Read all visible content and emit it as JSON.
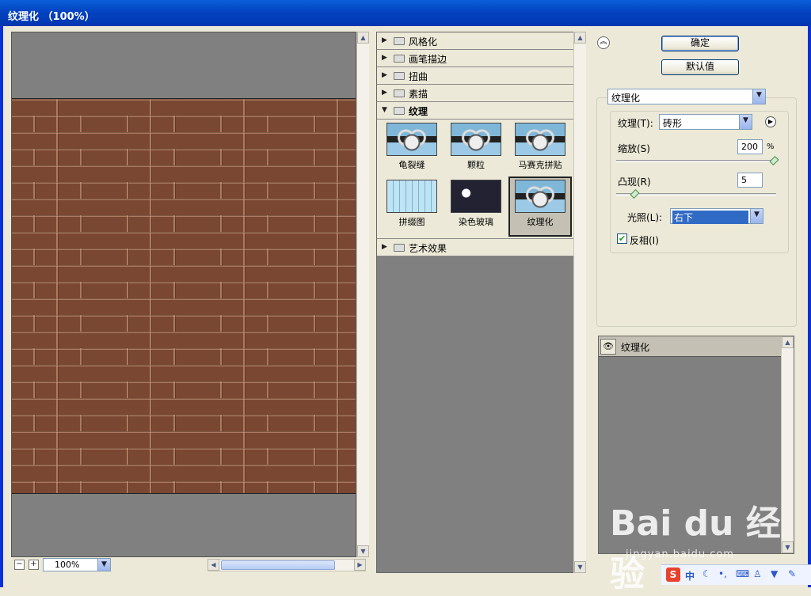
{
  "window": {
    "title": "纹理化 （100%）"
  },
  "preview": {
    "zoom": "100%"
  },
  "filter_gallery": {
    "categories_top": [
      "风格化",
      "画笔描边",
      "扭曲",
      "素描"
    ],
    "expanded": {
      "label": "纹理",
      "items": [
        {
          "label": "龟裂缝",
          "icon": "craquelure-thumbnail"
        },
        {
          "label": "颗粒",
          "icon": "grain-thumbnail"
        },
        {
          "label": "马赛克拼贴",
          "icon": "mosaic-tiles-thumbnail"
        },
        {
          "label": "拼缀图",
          "icon": "patchwork-thumbnail"
        },
        {
          "label": "染色玻璃",
          "icon": "stained-glass-thumbnail"
        },
        {
          "label": "纹理化",
          "icon": "texturizer-thumbnail",
          "selected": true
        }
      ]
    },
    "categories_bottom": [
      "艺术效果"
    ]
  },
  "buttons": {
    "ok": "确定",
    "default": "默认值"
  },
  "settings": {
    "filter_select": "纹理化",
    "texture_label": "纹理(T):",
    "texture_value": "砖形",
    "scaling_label": "缩放(S)",
    "scaling_value": "200",
    "scaling_unit": "%",
    "scaling_level": 1.0,
    "relief_label": "凸现(R)",
    "relief_value": "5",
    "relief_level": 0.1,
    "light_label": "光照(L):",
    "light_value": "右下",
    "invert_label": "反相(I)",
    "invert_checked": true
  },
  "layers": [
    {
      "name": "纹理化",
      "visible": true
    }
  ],
  "watermark": {
    "text": "Bai du 经验",
    "url": "jingyan.baidu.com"
  },
  "tray": {
    "ime_mode": "中"
  }
}
